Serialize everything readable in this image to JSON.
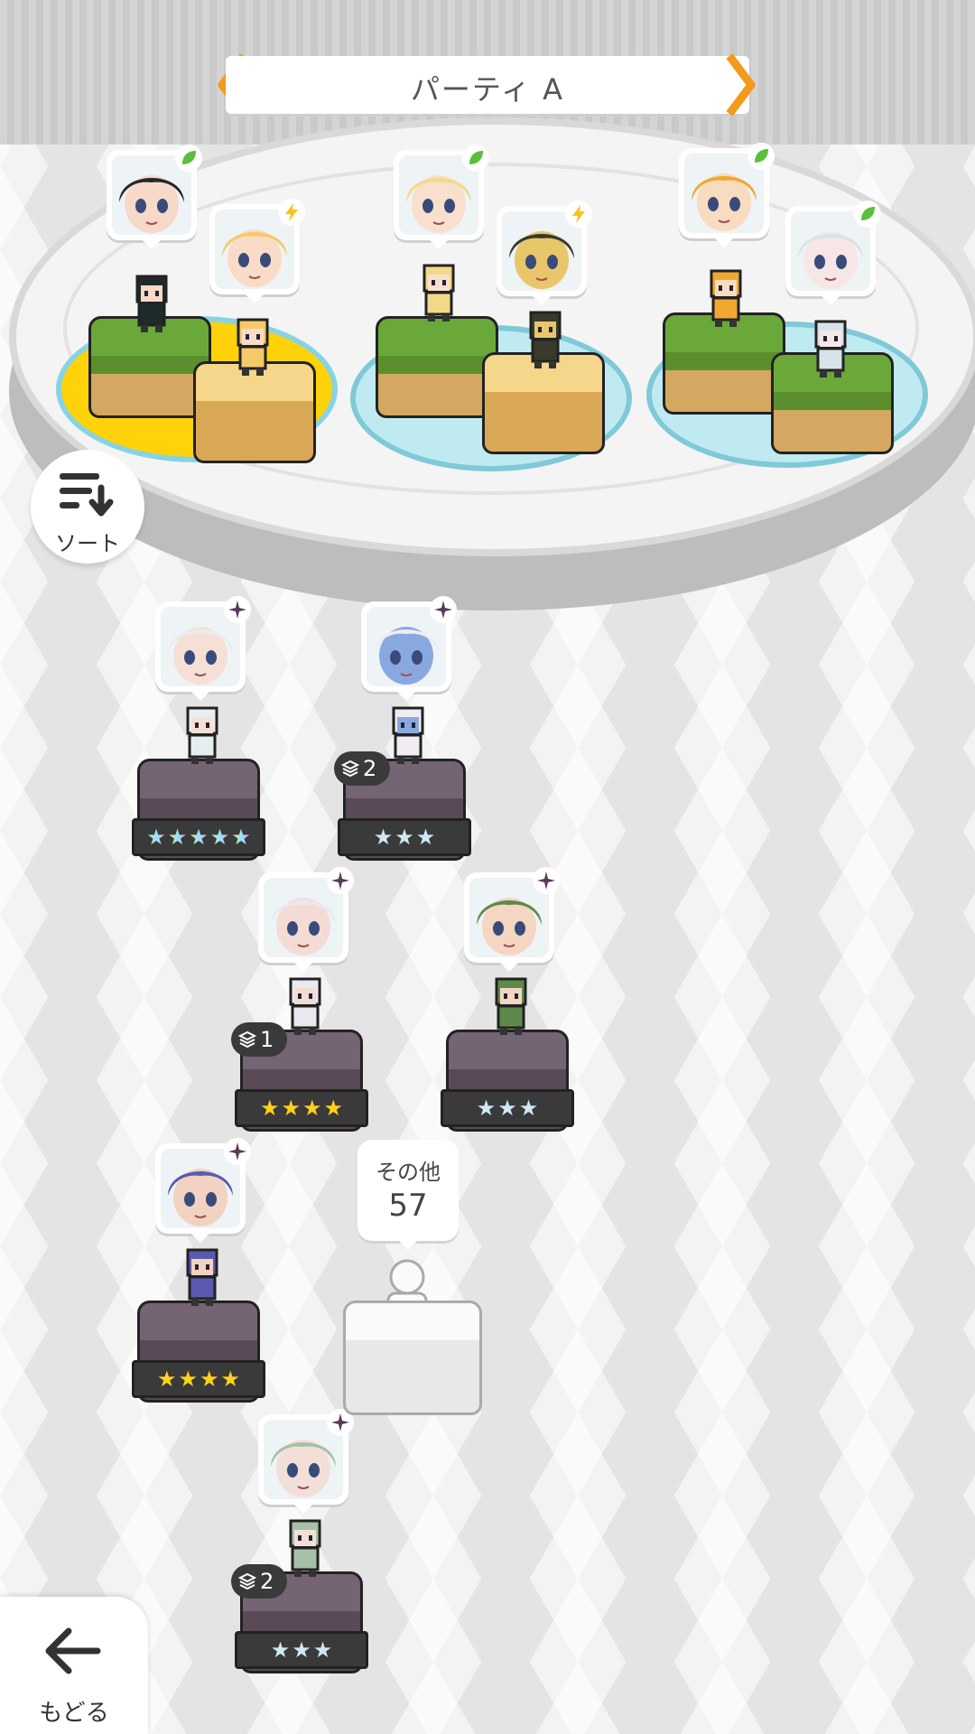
{
  "party": {
    "title": "パーティ A",
    "prev_icon": "chevron-left-icon",
    "next_icon": "chevron-right-icon"
  },
  "sort_button": {
    "label": "ソート",
    "icon": "sort-icon"
  },
  "back_button": {
    "label": "もどる",
    "icon": "arrow-left-icon"
  },
  "others": {
    "label": "その他",
    "count": "57"
  },
  "colors": {
    "accent_orange": "#f39a1b",
    "leaf_element": "#5bbf3a",
    "thunder_element": "#f6c21b",
    "dark_element": "#5a3a5a",
    "star_gold": "#ffd21a",
    "star_silver": "#cfe8f4"
  },
  "party_slots": [
    {
      "element": "leaf",
      "hair": "#1f2a2a",
      "skin": "#f6d9c8"
    },
    {
      "element": "thunder",
      "hair": "#f6c96a",
      "skin": "#f8dcc8"
    },
    {
      "element": "leaf",
      "hair": "#f4d88a",
      "skin": "#f8e0cc"
    },
    {
      "element": "thunder",
      "hair": "#3a3a2a",
      "skin": "#e8c66a"
    },
    {
      "element": "leaf",
      "hair": "#f0a830",
      "skin": "#f8dcc0"
    },
    {
      "element": "leaf",
      "hair": "#d6e4ea",
      "skin": "#f6e6e6"
    }
  ],
  "roster": [
    {
      "element": "dark",
      "stars": 5,
      "star_style": "rainbow",
      "badge": "",
      "hair": "#e6eef2",
      "skin": "#f6e0d6"
    },
    {
      "element": "dark",
      "stars": 3,
      "star_style": "silver",
      "badge": "2",
      "hair": "#f0ecf2",
      "skin": "#8aa8e0"
    },
    {
      "element": "dark",
      "stars": 4,
      "star_style": "gold",
      "badge": "1",
      "hair": "#e8eaf0",
      "skin": "#f4dcd4"
    },
    {
      "element": "dark",
      "stars": 3,
      "star_style": "silver",
      "badge": "",
      "hair": "#5d8a4a",
      "skin": "#f4d6c2"
    },
    {
      "element": "dark",
      "stars": 4,
      "star_style": "gold",
      "badge": "",
      "hair": "#5a5ab0",
      "skin": "#f2d2c0"
    },
    {
      "element": "dark",
      "stars": 3,
      "star_style": "silver",
      "badge": "2",
      "hair": "#a8c0a8",
      "skin": "#f2e0d8"
    }
  ]
}
